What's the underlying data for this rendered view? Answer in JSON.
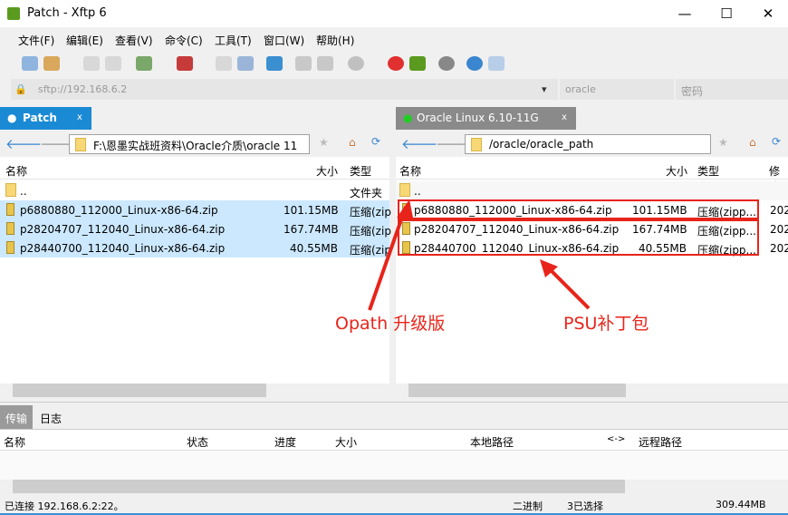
{
  "window": {
    "title": "Patch - Xftp 6",
    "minimize": "—",
    "maximize": "☐",
    "close": "✕"
  },
  "menu": [
    "文件(F)",
    "编辑(E)",
    "查看(V)",
    "命令(C)",
    "工具(T)",
    "窗口(W)",
    "帮助(H)"
  ],
  "address": {
    "url": "sftp://192.168.6.2",
    "user": "oracle",
    "password_placeholder": "密码"
  },
  "left": {
    "tab": "Patch",
    "tab_close": "x",
    "path": "F:\\恩墨实战班资料\\Oracle介质\\oracle 11",
    "headers": {
      "name": "名称",
      "size": "大小",
      "type": "类型"
    },
    "rows": [
      {
        "name": "..",
        "size": "",
        "type": "文件夹",
        "selected": false
      },
      {
        "name": "p6880880_112000_Linux-x86-64.zip",
        "size": "101.15MB",
        "type": "压缩(zip",
        "selected": true
      },
      {
        "name": "p28204707_112040_Linux-x86-64.zip",
        "size": "167.74MB",
        "type": "压缩(zip",
        "selected": true
      },
      {
        "name": "p28440700_112040_Linux-x86-64.zip",
        "size": "40.55MB",
        "type": "压缩(zip",
        "selected": true
      }
    ]
  },
  "right": {
    "tab": "Oracle Linux 6.10-11G",
    "tab_close": "x",
    "path": "/oracle/oracle_path",
    "headers": {
      "name": "名称",
      "size": "大小",
      "type": "类型",
      "modified": "修改"
    },
    "rows": [
      {
        "name": "..",
        "size": "",
        "type": "",
        "mod": ""
      },
      {
        "name": "p6880880_112000_Linux-x86-64.zip",
        "size": "101.15MB",
        "type": "压缩(zipp...",
        "mod": "202"
      },
      {
        "name": "p28204707_112040_Linux-x86-64.zip",
        "size": "167.74MB",
        "type": "压缩(zipp...",
        "mod": "202"
      },
      {
        "name": "p28440700_112040_Linux-x86-64.zip",
        "size": "40.55MB",
        "type": "压缩(zipp...",
        "mod": "202"
      }
    ]
  },
  "annotations": {
    "opatch": "Opath 升级版",
    "psu": "PSU补丁包",
    "color": "#e8241a"
  },
  "transfer": {
    "tabs": [
      "传输",
      "日志"
    ],
    "headers": [
      "名称",
      "状态",
      "进度",
      "大小",
      "本地路径",
      "<->",
      "远程路径"
    ]
  },
  "status": {
    "connected": "已连接 192.168.6.2:22。",
    "mode": "二进制",
    "selected": "3已选择",
    "total": "309.44MB"
  }
}
